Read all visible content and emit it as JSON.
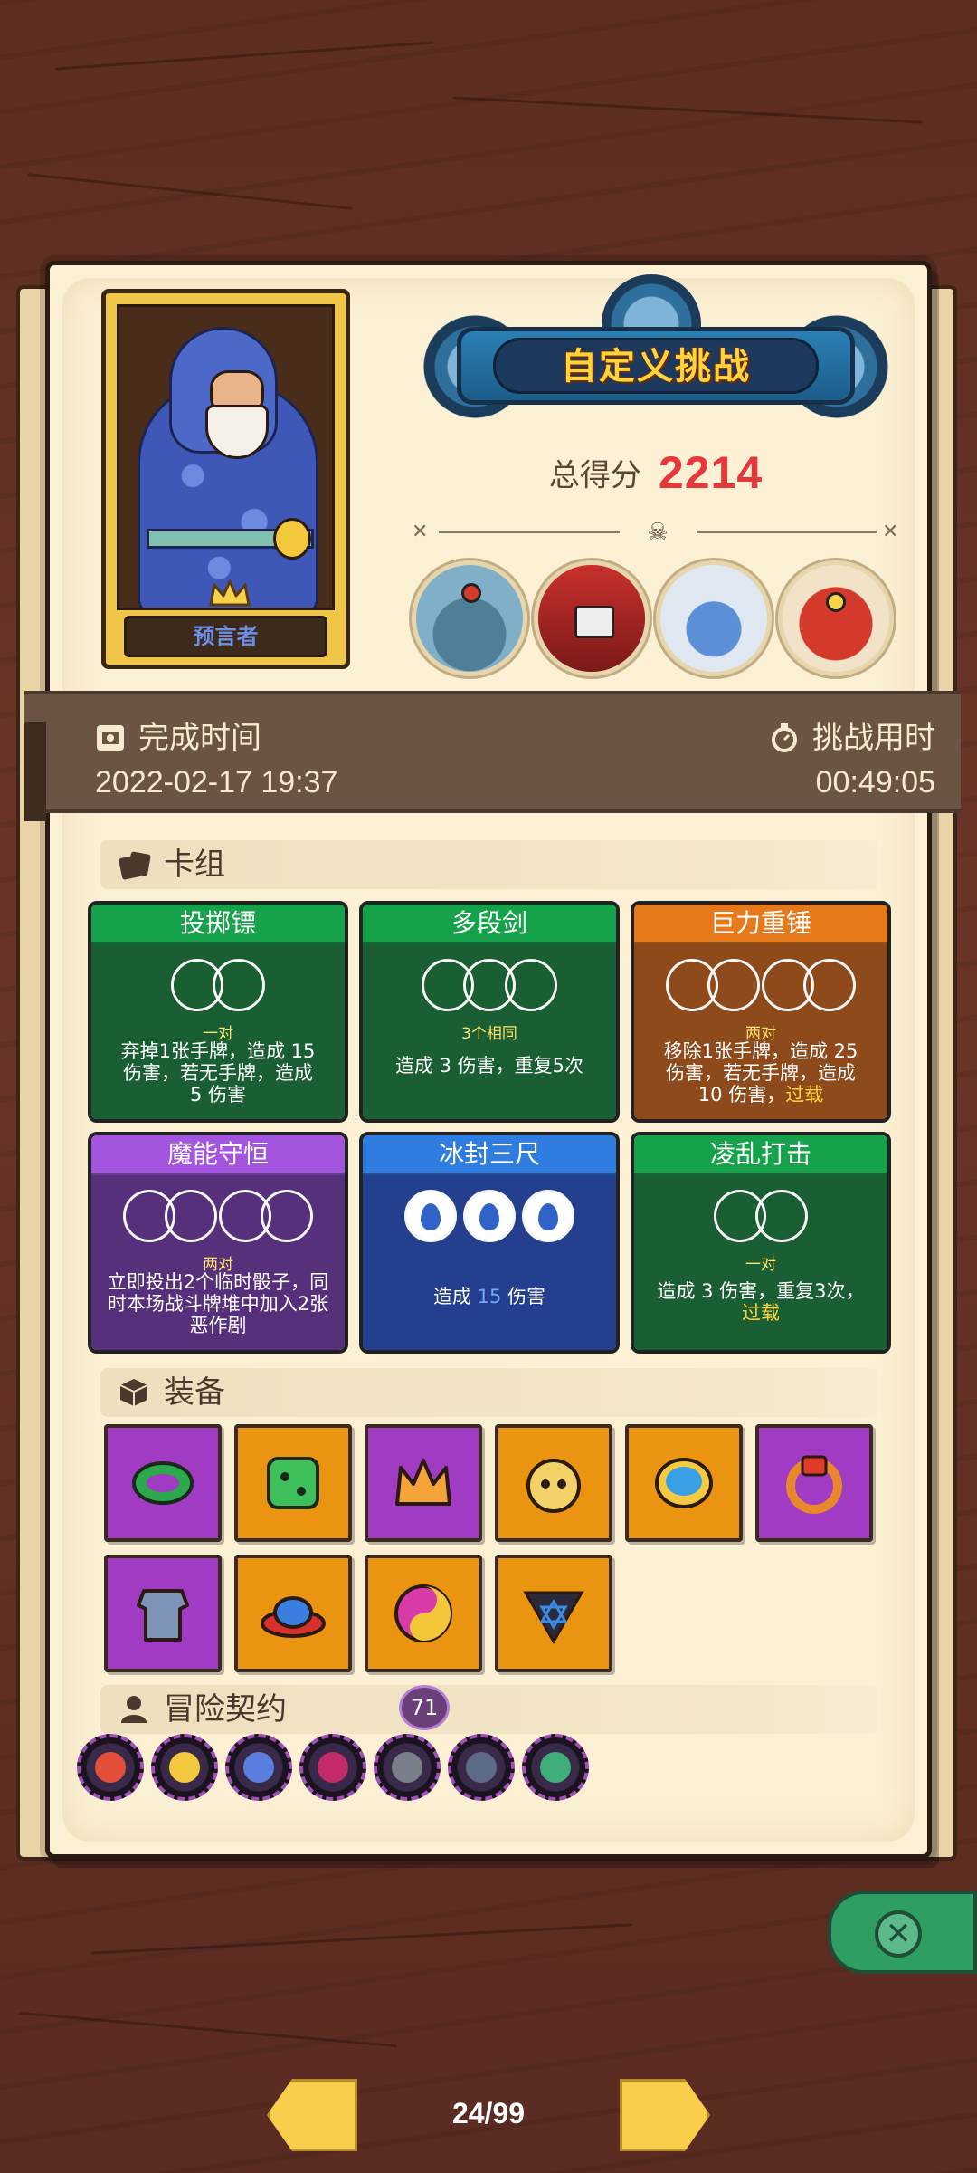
{
  "hero": {
    "label": "预言者"
  },
  "header": {
    "title": "自定义挑战",
    "score_label": "总得分",
    "score_value": "2214"
  },
  "info": {
    "complete_label": "完成时间",
    "complete_value": "2022-02-17 19:37",
    "duration_label": "挑战用时",
    "duration_value": "00:49:05"
  },
  "deck": {
    "section_label": "卡组",
    "cards": [
      {
        "title": "投掷镖",
        "condition": "一对",
        "desc": [
          "弃掉1张手牌，造成 15",
          "伤害，若无手牌，造成",
          "5 伤害"
        ]
      },
      {
        "title": "多段剑",
        "condition": "3个相同",
        "desc": [
          "造成 3 伤害，重复5次"
        ]
      },
      {
        "title": "巨力重锤",
        "condition": "两对",
        "desc": [
          "移除1张手牌，造成 25",
          "伤害，若无手牌，造成",
          "10 伤害，"
        ],
        "highlight": "过载"
      },
      {
        "title": "魔能守恒",
        "condition": "两对",
        "desc": [
          "立即投出2个临时骰子，同",
          "时本场战斗牌堆中加入2张",
          "恶作剧"
        ]
      },
      {
        "title": "冰封三尺",
        "condition": "",
        "desc_prefix": "造成 ",
        "desc_value": "15",
        "desc_suffix": " 伤害"
      },
      {
        "title": "凌乱打击",
        "condition": "一对",
        "desc": [
          "造成 3 伤害，重复3次，"
        ],
        "highlight": "过载"
      }
    ]
  },
  "equipment": {
    "section_label": "装备"
  },
  "contract": {
    "section_label": "冒险契约",
    "count": "71"
  },
  "nav": {
    "page": "24/99"
  },
  "colors": {
    "score": "#e5383b",
    "title_yellow": "#ffd43b",
    "panel": "#fbf0d4"
  }
}
